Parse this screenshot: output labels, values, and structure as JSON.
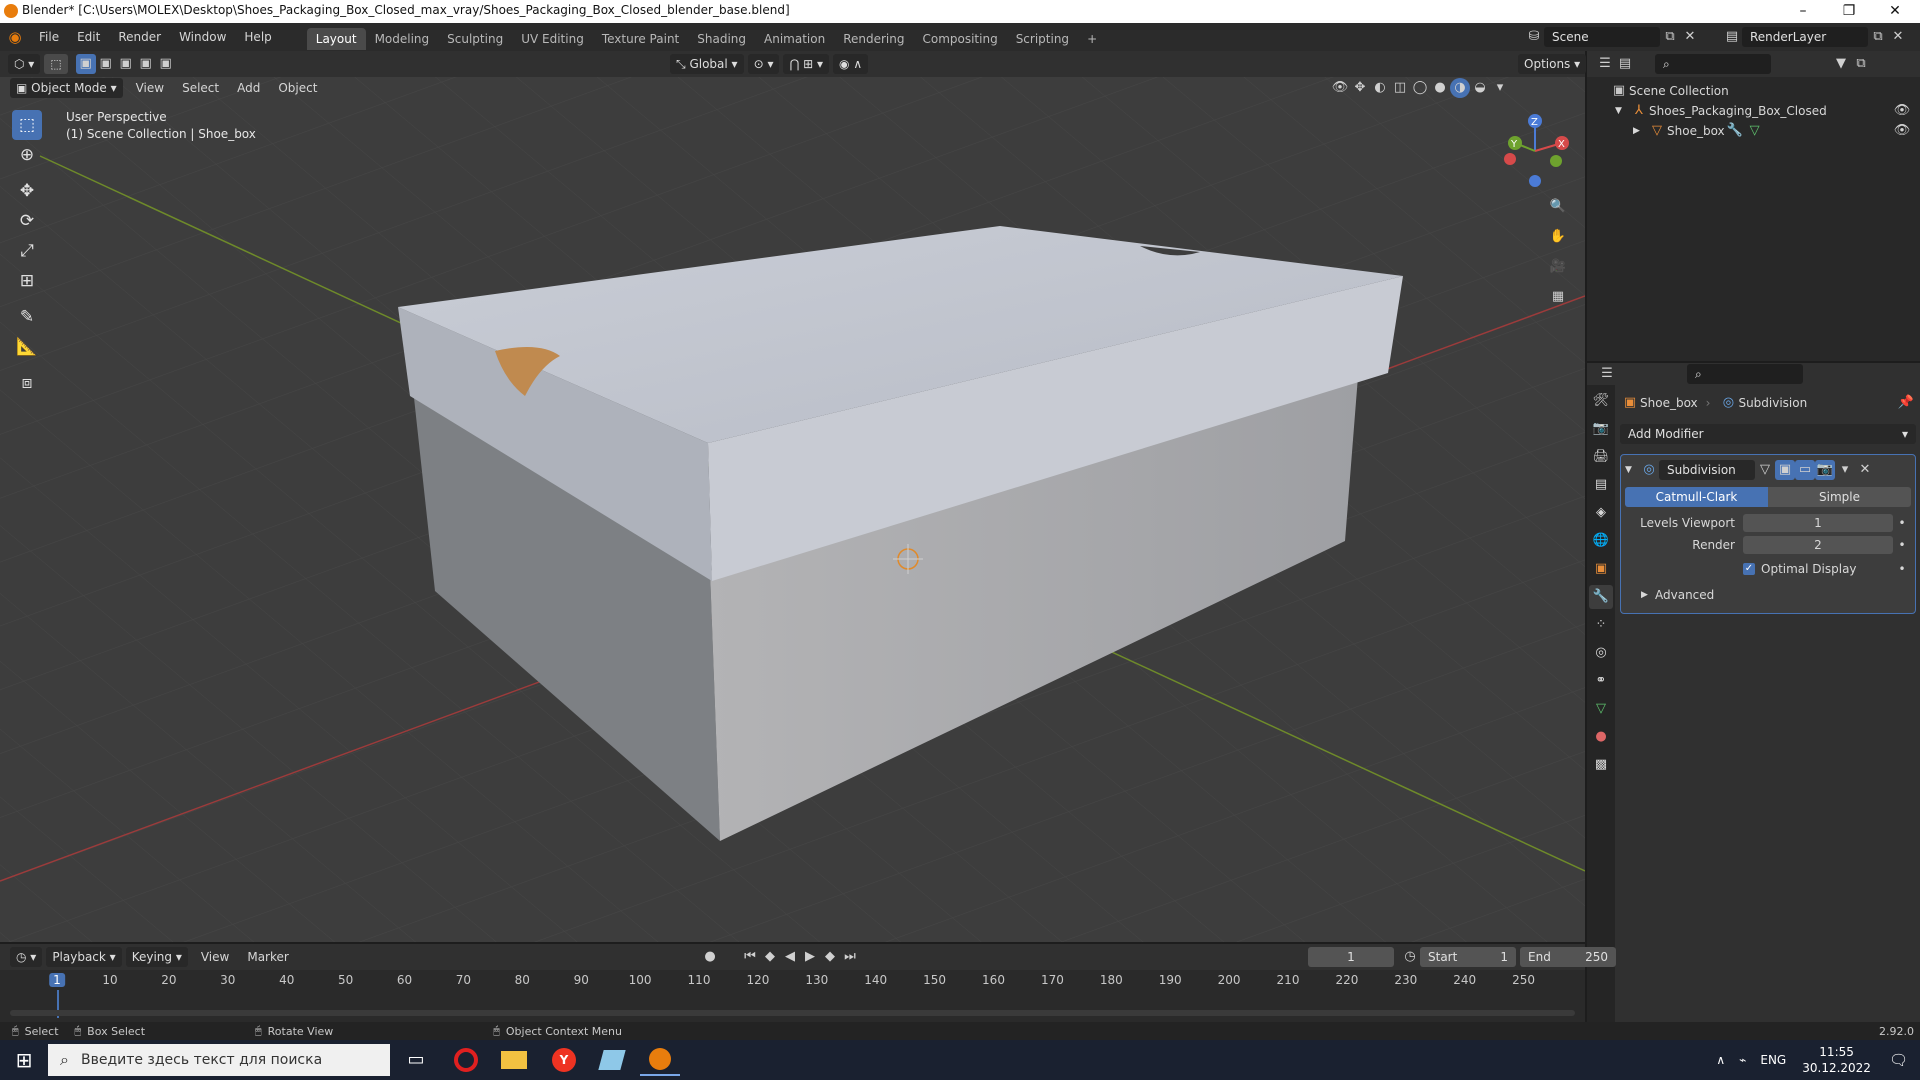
{
  "window": {
    "title": "Blender* [C:\\Users\\MOLEX\\Desktop\\Shoes_Packaging_Box_Closed_max_vray/Shoes_Packaging_Box_Closed_blender_base.blend]",
    "minimize": "–",
    "maximize": "❐",
    "close": "✕"
  },
  "menu": {
    "items": [
      "File",
      "Edit",
      "Render",
      "Window",
      "Help"
    ],
    "workspaces": [
      "Layout",
      "Modeling",
      "Sculpting",
      "UV Editing",
      "Texture Paint",
      "Shading",
      "Animation",
      "Rendering",
      "Compositing",
      "Scripting"
    ],
    "add_workspace": "+",
    "scene": "Scene",
    "render_layer": "RenderLayer"
  },
  "viewport": {
    "transform_orientation": "Global",
    "options": "Options",
    "mode": "Object Mode",
    "menu": [
      "View",
      "Select",
      "Add",
      "Object"
    ],
    "overlay_title": "User Perspective",
    "overlay_subtitle": "(1) Scene Collection | Shoe_box",
    "gizmo": {
      "x": "X",
      "y": "Y",
      "z": "Z"
    }
  },
  "outliner": {
    "root": "Scene Collection",
    "collection": "Shoes_Packaging_Box_Closed",
    "object": "Shoe_box"
  },
  "properties": {
    "breadcrumb_object": "Shoe_box",
    "breadcrumb_modifier": "Subdivision",
    "add_modifier": "Add Modifier",
    "modifier_name": "Subdivision",
    "method_active": "Catmull-Clark",
    "method_other": "Simple",
    "levels_viewport_label": "Levels Viewport",
    "levels_viewport_value": "1",
    "render_label": "Render",
    "render_value": "2",
    "optimal_display_label": "Optimal Display",
    "advanced_label": "Advanced"
  },
  "timeline": {
    "menu": [
      "Playback",
      "Keying",
      "View",
      "Marker"
    ],
    "current_frame": "1",
    "start_label": "Start",
    "start_value": "1",
    "end_label": "End",
    "end_value": "250",
    "ticks": [
      "1",
      "10",
      "20",
      "30",
      "40",
      "50",
      "60",
      "70",
      "80",
      "90",
      "100",
      "110",
      "120",
      "130",
      "140",
      "150",
      "160",
      "170",
      "180",
      "190",
      "200",
      "210",
      "220",
      "230",
      "240",
      "250"
    ]
  },
  "statusbar": {
    "select": "Select",
    "box_select": "Box Select",
    "rotate_view": "Rotate View",
    "context_menu": "Object Context Menu",
    "version": "2.92.0"
  },
  "taskbar": {
    "search_placeholder": "Введите здесь текст для поиска",
    "lang": "ENG",
    "time": "11:55",
    "date": "30.12.2022"
  },
  "colors": {
    "accent": "#4772b3",
    "blender_orange": "#e87d0d",
    "viewport_bg": "#3d3d3d"
  }
}
